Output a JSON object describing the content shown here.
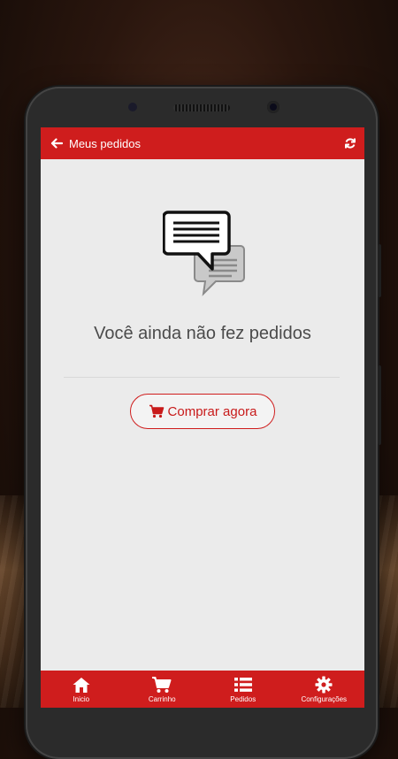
{
  "appbar": {
    "title": "Meus pedidos"
  },
  "empty_state": {
    "message": "Você ainda não fez pedidos",
    "button_label": "Comprar agora"
  },
  "bottom_nav": {
    "items": [
      {
        "label": "Inicio",
        "icon": "home-icon"
      },
      {
        "label": "Carrinho",
        "icon": "cart-icon"
      },
      {
        "label": "Pedidos",
        "icon": "list-icon"
      },
      {
        "label": "Configurações",
        "icon": "gear-icon"
      }
    ]
  },
  "colors": {
    "brand": "#cf1d1d",
    "screen_bg": "#ebebeb",
    "text": "#4b4b4b"
  }
}
